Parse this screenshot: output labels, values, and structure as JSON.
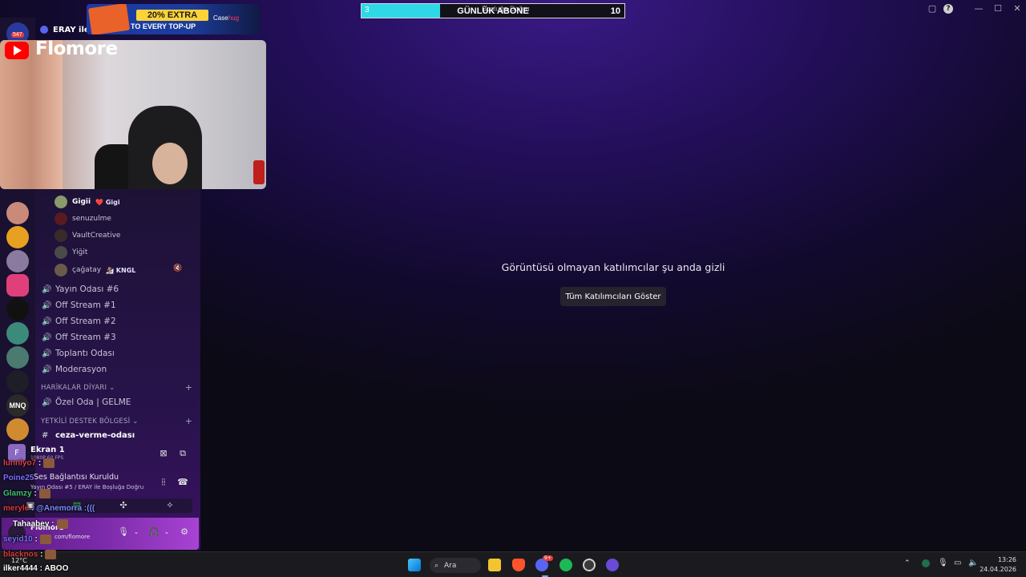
{
  "goal": {
    "current": "3",
    "title": "GÜNLÜK ABONE",
    "max": "10",
    "fill_fraction": 0.3,
    "under_text": "Boşluğa Doğru"
  },
  "topbar": {
    "restore_icon": "▢",
    "help_icon": "?",
    "minimize": "—",
    "maximize": "☐",
    "close": "✕"
  },
  "ad": {
    "extra": "20% EXTRA",
    "topup": "TO EVERY TOP-UP",
    "brand": "Case",
    "brand_highlight": "hug"
  },
  "call": {
    "label": "ERAY ile",
    "badge": "547"
  },
  "stream": {
    "name": "Flomore"
  },
  "members": [
    {
      "name": "Gigii",
      "tag": "❤️ Gigi"
    },
    {
      "name": "senuzulme",
      "tag": ""
    },
    {
      "name": "VaultCreative",
      "tag": ""
    },
    {
      "name": "Yiğit",
      "tag": ""
    },
    {
      "name": "çağatay",
      "tag": "🏂 KNGL"
    }
  ],
  "voice_channels": [
    "Yayın Odası #6",
    "Off Stream #1",
    "Off Stream #2",
    "Off Stream #3",
    "Toplantı Odası",
    "Moderasyon"
  ],
  "categories": [
    {
      "name": "HARİKALAR DİYARI",
      "channel": "Özel Oda | GELME"
    },
    {
      "name": "YETKİLİ DESTEK BÖLGESİ",
      "channel": "ceza-verme-odası"
    }
  ],
  "voice_panel": {
    "screen_label": "Ekran 1",
    "screen_sub": "1080P 60 FPS",
    "connection": "Ses Bağlantısı Kuruldu",
    "room": "Yayın Odası #5 / ERAY ile Boşluğa Doğru"
  },
  "user": {
    "name": "Flomore",
    "sub": "com/flomore"
  },
  "main": {
    "hidden_message": "Görüntüsü olmayan katılımcılar şu anda gizli",
    "show_button": "Tüm Katılımcıları Göster"
  },
  "chat": [
    {
      "user": "lunnlyo7",
      "msg": ":",
      "color": "#e0404a"
    },
    {
      "user": "Poine25",
      "msg": "",
      "color": "#7b6cff"
    },
    {
      "user": "Glamzy",
      "msg": ":",
      "color": "#40c070"
    },
    {
      "user": "meryle",
      "msg": ": @Anemorra :(((",
      "color": "#d83a3a"
    },
    {
      "user": "Tahaabey",
      "msg": ":",
      "color": "#ffffff"
    },
    {
      "user": "seyid10",
      "msg": ":",
      "color": "#7b6cff"
    },
    {
      "user": "blacknos",
      "msg": ":",
      "color": "#d83a3a"
    },
    {
      "user": "ilker4444",
      "msg": ": ABOO",
      "color": "#ffffff"
    }
  ],
  "taskbar": {
    "search": "Ara",
    "weather": "12°C",
    "time": "13:26",
    "date": "24.04.2026",
    "discord_badge": "9+"
  },
  "colors": {
    "accent": "#2fd8e6",
    "panel_purple": "#7a2aa8",
    "bg_purple": "#240f5c"
  }
}
